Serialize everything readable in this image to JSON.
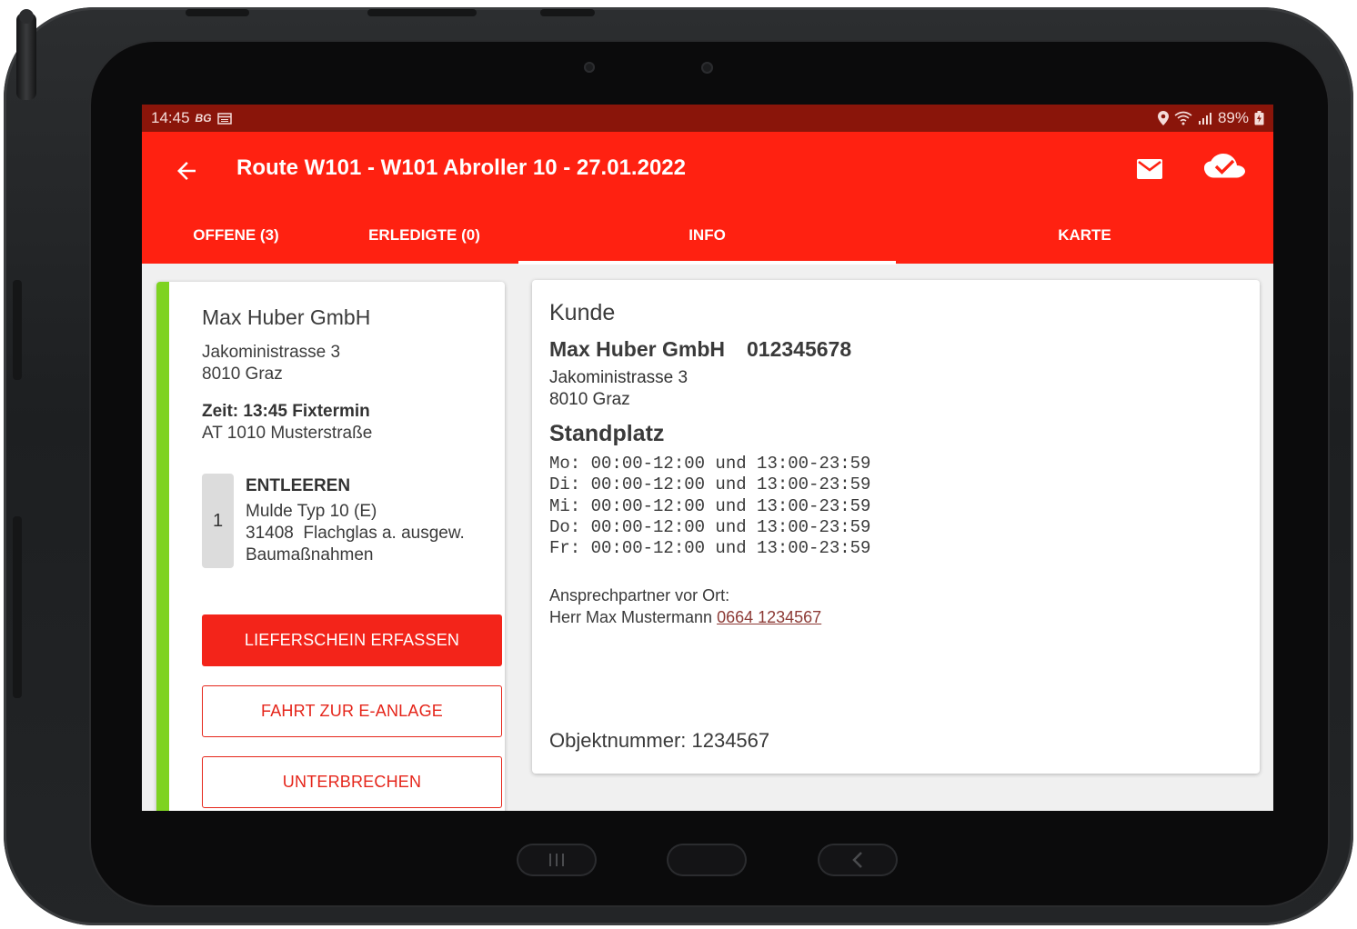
{
  "status_bar": {
    "time": "14:45",
    "badge": "BG",
    "battery": "89%"
  },
  "app_bar": {
    "title": "Route W101 - W101 Abroller 10 - 27.01.2022"
  },
  "tabs": [
    {
      "label": "OFFENE (3)"
    },
    {
      "label": "ERLEDIGTE (0)"
    },
    {
      "label": "INFO",
      "selected": true
    },
    {
      "label": "KARTE"
    }
  ],
  "stop_card": {
    "customer": "Max Huber GmbH",
    "street": "Jakoministrasse 3",
    "city": "8010 Graz",
    "zeit": "Zeit: 13:45 Fixtermin",
    "location": "AT 1010 Musterstraße",
    "task": {
      "number": "1",
      "title": "ENTLEEREN",
      "line1": "Mulde Typ 10 (E)",
      "line2": "31408  Flachglas a. ausgew.",
      "line3": "Baumaßnahmen"
    },
    "buttons": {
      "primary": "LIEFERSCHEIN ERFASSEN",
      "secondary": "FAHRT ZUR E-ANLAGE",
      "tertiary": "UNTERBRECHEN"
    },
    "accent_color": "#7ed321"
  },
  "info_card": {
    "kunde_heading": "Kunde",
    "customer_name": "Max Huber GmbH",
    "customer_number": "012345678",
    "street": "Jakoministrasse 3",
    "city": "8010 Graz",
    "standplatz_heading": "Standplatz",
    "hours": [
      "Mo: 00:00-12:00 und 13:00-23:59",
      "Di: 00:00-12:00 und 13:00-23:59",
      "Mi: 00:00-12:00 und 13:00-23:59",
      "Do: 00:00-12:00 und 13:00-23:59",
      "Fr: 00:00-12:00 und 13:00-23:59"
    ],
    "contact_label": "Ansprechpartner vor Ort:",
    "contact_name": "Herr Max Mustermann",
    "contact_phone": "0664 1234567",
    "objekt": "Objektnummer: 1234567"
  },
  "colors": {
    "primary": "#ff2111",
    "status_bar": "#8a150a",
    "accent_green": "#7ed321",
    "link": "#8d3b36"
  },
  "icons": [
    "back-arrow-icon",
    "mail-icon",
    "cloud-check-icon",
    "location-icon",
    "wifi-icon",
    "signal-icon",
    "battery-icon"
  ]
}
